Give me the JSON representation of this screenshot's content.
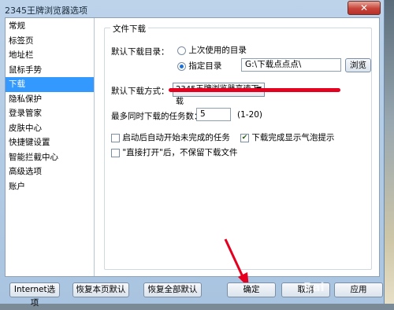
{
  "window": {
    "title": "2345王牌浏览器选项",
    "close_label": "✕"
  },
  "sidebar": {
    "items": [
      {
        "label": "常规"
      },
      {
        "label": "标签页"
      },
      {
        "label": "地址栏"
      },
      {
        "label": "鼠标手势"
      },
      {
        "label": "下载",
        "selected": true
      },
      {
        "label": "隐私保护"
      },
      {
        "label": "登录管家"
      },
      {
        "label": "皮肤中心"
      },
      {
        "label": "快捷键设置"
      },
      {
        "label": "智能拦截中心"
      },
      {
        "label": "高级选项"
      },
      {
        "label": "账户"
      }
    ]
  },
  "download": {
    "group_title": "文件下载",
    "dir_label": "默认下载目录：",
    "option_last": "上次使用的目录",
    "option_specified": "指定目录",
    "dir_value": "G:\\下载点点点\\",
    "browse_label": "浏览",
    "method_label": "默认下载方式：",
    "method_value": "2345王牌浏览器高速下载",
    "max_tasks_label": "最多同时下载的任务数：",
    "max_tasks_value": "5",
    "max_tasks_range": "(1-20)",
    "auto_resume_label": "启动后自动开始未完成的任务",
    "auto_resume_checked": false,
    "notify_label": "下载完成显示气泡提示",
    "notify_checked": true,
    "direct_open_label": "\"直接打开\"后，不保留下载文件",
    "direct_open_checked": false
  },
  "footer": {
    "internet_options": "Internet选项",
    "restore_page": "恢复本页默认",
    "restore_all": "恢复全部默认",
    "ok": "确定",
    "cancel": "取消",
    "apply": "应用"
  },
  "colors": {
    "selected": "#3399ff",
    "annotation": "#e4001e"
  },
  "watermark": "Bai"
}
